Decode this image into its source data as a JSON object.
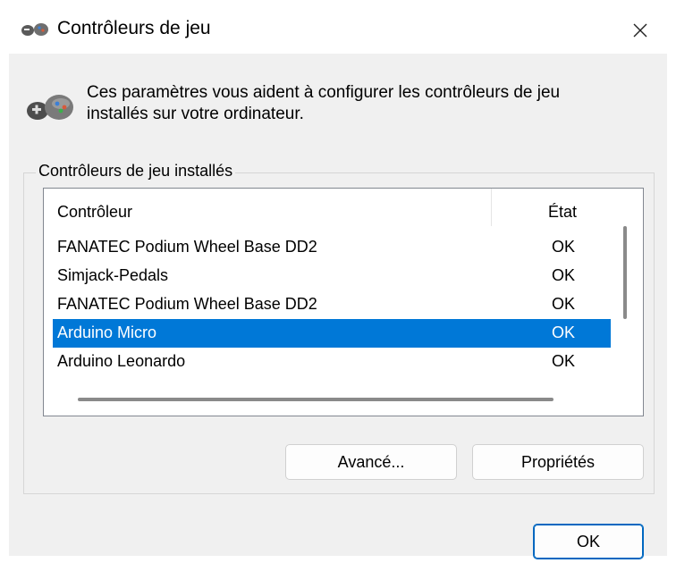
{
  "window": {
    "title": "Contrôleurs de jeu",
    "close_glyph": "✕"
  },
  "description": "Ces paramètres vous aident à configurer les contrôleurs de jeu installés sur votre ordinateur.",
  "group": {
    "label": "Contrôleurs de jeu installés",
    "columns": {
      "controller": "Contrôleur",
      "state": "État"
    },
    "rows": [
      {
        "name": "FANATEC Podium Wheel Base DD2",
        "state": "OK",
        "selected": false
      },
      {
        "name": "Simjack-Pedals",
        "state": "OK",
        "selected": false
      },
      {
        "name": "FANATEC Podium Wheel Base DD2",
        "state": "OK",
        "selected": false
      },
      {
        "name": "Arduino Micro",
        "state": "OK",
        "selected": true
      },
      {
        "name": "Arduino Leonardo",
        "state": "OK",
        "selected": false
      }
    ]
  },
  "buttons": {
    "advanced": "Avancé...",
    "properties": "Propriétés",
    "ok": "OK"
  },
  "colors": {
    "selection": "#0078d7",
    "window_bg": "#f0f0f0",
    "accent_border": "#0067c0"
  },
  "icons": {
    "title": "gamepad-icon",
    "header": "gamepad-icon",
    "close": "close-icon"
  }
}
